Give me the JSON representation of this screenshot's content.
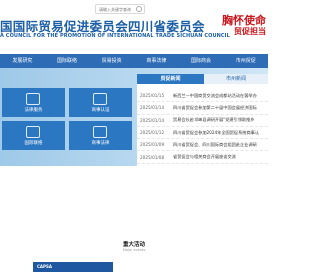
{
  "header": {
    "search_placeholder": "请输入关键字查询",
    "logo_cn": "国国际贸易促进委员会四川省委员会",
    "logo_en": "A COUNCIL FOR THE PROMOTION OF INTERNATIONAL TRADE SICHUAN COUNCIL",
    "slogan_line1": "胸怀使命",
    "slogan_line2": "贸促担当"
  },
  "nav": {
    "items": [
      {
        "label": "发展研究"
      },
      {
        "label": "国际联络"
      },
      {
        "label": "贸易投资"
      },
      {
        "label": "商事法律"
      },
      {
        "label": "国际商会"
      },
      {
        "label": "市州贸促"
      }
    ]
  },
  "tiles": [
    {
      "label": "法律服务"
    },
    {
      "label": "商事认证"
    },
    {
      "label": "国际联络"
    },
    {
      "label": "商事法律"
    }
  ],
  "news": {
    "tab_active": "贸促新闻",
    "tab_inactive": "市州新闻",
    "rows": [
      {
        "date": "2025/01/15",
        "title": "新西兰—中国商贸交流会成都站活动在蓉举办"
      },
      {
        "date": "2025/01/14",
        "title": "四川省贸促会参加第二十届中国会展经济国际"
      },
      {
        "date": "2025/01/14",
        "title": "贸易会长赴邛崃县调研开展\"党建引领助推乡"
      },
      {
        "date": "2025/01/12",
        "title": "四川省贸促会参加2024年全国贸促系统商事认"
      },
      {
        "date": "2025/01/09",
        "title": "四川省贸促会、四川国际商会组团赴企业调研"
      },
      {
        "date": "2025/01/08",
        "title": "省贸促会与相关商会开展座谈交流"
      }
    ]
  },
  "section": {
    "title": "重大活动",
    "subtitle": "Major events",
    "card_label": "CAPSA"
  }
}
